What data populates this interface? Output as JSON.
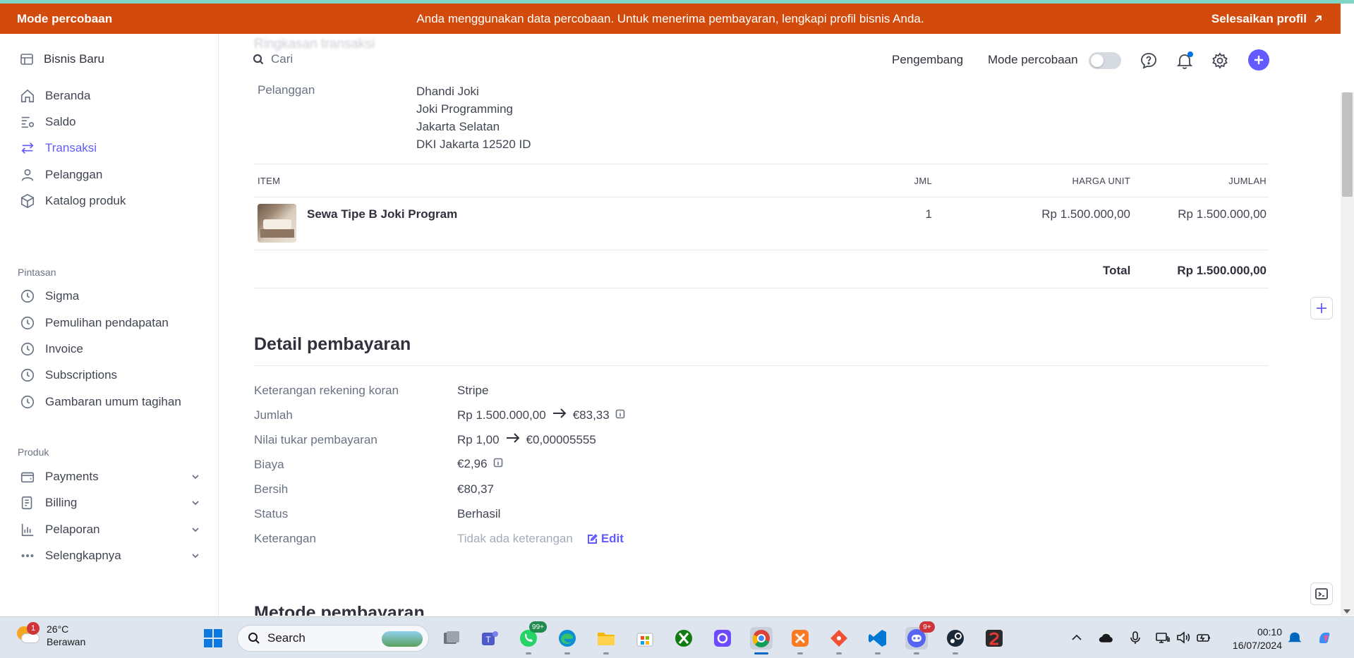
{
  "banner": {
    "left": "Mode percobaan",
    "message": "Anda menggunakan data percobaan. Untuk menerima pembayaran, lengkapi profil bisnis Anda.",
    "action": "Selesaikan profil"
  },
  "sidebar": {
    "business": "Bisnis Baru",
    "main_items": [
      {
        "label": "Beranda",
        "icon": "home-icon"
      },
      {
        "label": "Saldo",
        "icon": "balance-icon"
      },
      {
        "label": "Transaksi",
        "icon": "transactions-icon",
        "active": true
      },
      {
        "label": "Pelanggan",
        "icon": "user-icon"
      },
      {
        "label": "Katalog produk",
        "icon": "box-icon"
      }
    ],
    "shortcuts_label": "Pintasan",
    "shortcuts": [
      "Sigma",
      "Pemulihan pendapatan",
      "Invoice",
      "Subscriptions",
      "Gambaran umum tagihan"
    ],
    "products_label": "Produk",
    "products": [
      {
        "label": "Payments",
        "icon": "wallet-icon"
      },
      {
        "label": "Billing",
        "icon": "billing-icon"
      },
      {
        "label": "Pelaporan",
        "icon": "chart-icon"
      },
      {
        "label": "Selengkapnya",
        "icon": "more-icon"
      }
    ]
  },
  "header": {
    "search_placeholder": "Cari",
    "developer": "Pengembang",
    "test_mode": "Mode percobaan",
    "test_mode_on": false,
    "faded_heading": "Ringkasan transaksi"
  },
  "customer": {
    "label": "Pelanggan",
    "lines": [
      "Dhandi Joki",
      "Joki Programming",
      "Jakarta Selatan",
      "DKI Jakarta 12520 ID"
    ]
  },
  "items_table": {
    "headers": {
      "item": "ITEM",
      "qty": "JML",
      "unit_price": "HARGA UNIT",
      "amount": "JUMLAH"
    },
    "rows": [
      {
        "name": "Sewa Tipe B Joki Program",
        "qty": "1",
        "unit_price": "Rp 1.500.000,00",
        "amount": "Rp 1.500.000,00"
      }
    ],
    "total_label": "Total",
    "total_value": "Rp 1.500.000,00"
  },
  "payment": {
    "title": "Detail pembayaran",
    "statement_label": "Keterangan rekening koran",
    "statement_value": "Stripe",
    "amount_label": "Jumlah",
    "amount_from": "Rp 1.500.000,00",
    "amount_to": "€83,33",
    "rate_label": "Nilai tukar pembayaran",
    "rate_from": "Rp 1,00",
    "rate_to": "€0,00005555",
    "fee_label": "Biaya",
    "fee_value": "€2,96",
    "net_label": "Bersih",
    "net_value": "€80,37",
    "status_label": "Status",
    "status_value": "Berhasil",
    "note_label": "Keterangan",
    "note_value": "Tidak ada keterangan",
    "edit": "Edit"
  },
  "next_section": "Metode pembayaran",
  "taskbar": {
    "temperature": "26°C",
    "condition": "Berawan",
    "weather_badge": "1",
    "search": "Search",
    "whatsapp_badge": "99+",
    "discord_badge": "9+",
    "time": "00:10",
    "date": "16/07/2024"
  },
  "colors": {
    "accent": "#635bff",
    "banner": "#d24b0c",
    "text": "#30313d",
    "muted": "#6a7383"
  }
}
